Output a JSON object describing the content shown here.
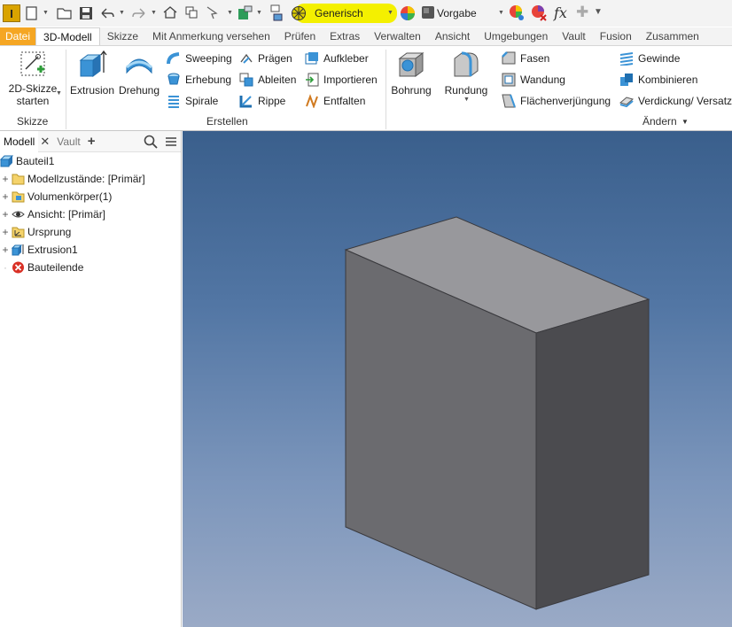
{
  "app": {
    "logo_text": "I"
  },
  "qat": {
    "appearance_value": "Generisch",
    "material_value": "Vorgabe",
    "fx_label": "fx"
  },
  "tabs": [
    {
      "label": "Datei"
    },
    {
      "label": "3D-Modell"
    },
    {
      "label": "Skizze"
    },
    {
      "label": "Mit Anmerkung versehen"
    },
    {
      "label": "Prüfen"
    },
    {
      "label": "Extras"
    },
    {
      "label": "Verwalten"
    },
    {
      "label": "Ansicht"
    },
    {
      "label": "Umgebungen"
    },
    {
      "label": "Vault"
    },
    {
      "label": "Fusion"
    },
    {
      "label": "Zusammen"
    }
  ],
  "ribbon": {
    "skizze": {
      "start_sketch_line1": "2D-Skizze",
      "start_sketch_line2": "starten",
      "panel_title": "Skizze"
    },
    "erstellen": {
      "extrusion": "Extrusion",
      "drehung": "Drehung",
      "sweeping": "Sweeping",
      "erhebung": "Erhebung",
      "spirale": "Spirale",
      "praegen": "Prägen",
      "ableiten": "Ableiten",
      "rippe": "Rippe",
      "aufkleber": "Aufkleber",
      "importieren": "Importieren",
      "entfalten": "Entfalten",
      "panel_title": "Erstellen"
    },
    "aendern": {
      "bohrung": "Bohrung",
      "rundung": "Rundung",
      "fasen": "Fasen",
      "wandung": "Wandung",
      "flaechenverjuengung": "Flächenverjüngung",
      "gewinde": "Gewinde",
      "kombinieren": "Kombinieren",
      "verdickung": "Verdickung/ Versatz",
      "panel_title": "Ändern"
    }
  },
  "browser": {
    "tab_model": "Modell",
    "tab_vault": "Vault",
    "tree": [
      {
        "label": "Bauteil1"
      },
      {
        "label": "Modellzustände: [Primär]"
      },
      {
        "label": "Volumenkörper(1)"
      },
      {
        "label": "Ansicht: [Primär]"
      },
      {
        "label": "Ursprung"
      },
      {
        "label": "Extrusion1"
      },
      {
        "label": "Bauteilende"
      }
    ]
  },
  "colors": {
    "file_tab": "#f5a623",
    "highlight": "#f4f000",
    "box_top": "#98989c",
    "box_left": "#6b6b6f",
    "box_right": "#4b4b4f"
  }
}
